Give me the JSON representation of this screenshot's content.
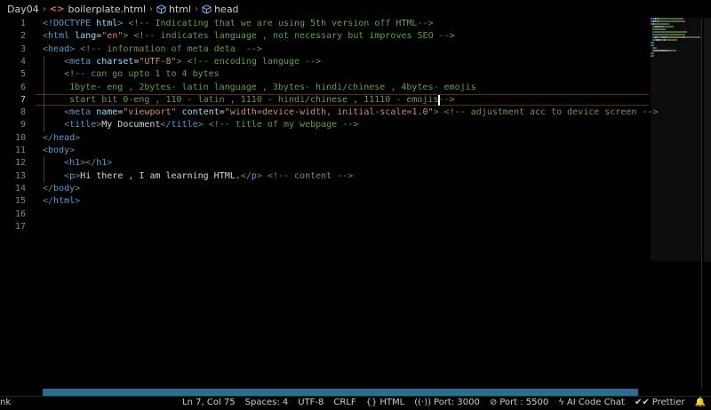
{
  "breadcrumb": {
    "folder": "Day04",
    "file": "boilerplate.html",
    "file_icon": "<>",
    "symbol1": "html",
    "symbol2": "head"
  },
  "editor": {
    "active_line": 7,
    "lines": [
      {
        "n": "1",
        "indent": 0,
        "t": [
          [
            "d",
            "<!DOCTYPE"
          ],
          [
            "x",
            " "
          ],
          [
            "a",
            "html"
          ],
          [
            "d",
            ">"
          ],
          [
            "x",
            " "
          ],
          [
            "c",
            "<!-- Indicating that we are using 5th version off HTML-->"
          ]
        ]
      },
      {
        "n": "2",
        "indent": 0,
        "t": [
          [
            "p",
            "<"
          ],
          [
            "t",
            "html"
          ],
          [
            "x",
            " "
          ],
          [
            "a",
            "lang"
          ],
          [
            "x",
            "="
          ],
          [
            "s",
            "\"en\""
          ],
          [
            "p",
            ">"
          ],
          [
            "x",
            " "
          ],
          [
            "c",
            "<!-- indicates language , not necessary but improves SEO -->"
          ]
        ]
      },
      {
        "n": "3",
        "indent": 0,
        "t": [
          [
            "p",
            "<"
          ],
          [
            "t",
            "head"
          ],
          [
            "p",
            ">"
          ],
          [
            "x",
            " "
          ],
          [
            "c",
            "<!-- information of meta deta  -->"
          ]
        ]
      },
      {
        "n": "4",
        "indent": 1,
        "t": [
          [
            "p",
            "<"
          ],
          [
            "t",
            "meta"
          ],
          [
            "x",
            " "
          ],
          [
            "a",
            "charset"
          ],
          [
            "x",
            "="
          ],
          [
            "s",
            "\"UTF-8\""
          ],
          [
            "p",
            ">"
          ],
          [
            "x",
            " "
          ],
          [
            "c",
            "<!-- encoding languge -->"
          ]
        ]
      },
      {
        "n": "5",
        "indent": 1,
        "t": [
          [
            "c",
            "<!-- can go upto 1 to 4 bytes"
          ]
        ]
      },
      {
        "n": "6",
        "indent": 1,
        "t": [
          [
            "c",
            " 1byte- eng , 2bytes- latin language , 3bytes- hindi/chinese , 4bytes- emojis"
          ]
        ]
      },
      {
        "n": "7",
        "indent": 1,
        "t": [
          [
            "c",
            " start bit 0-eng , 110 - latin , 1110 - hindi/chinese , 11110 - emojis-->"
          ]
        ]
      },
      {
        "n": "8",
        "indent": 1,
        "t": [
          [
            "p",
            "<"
          ],
          [
            "t",
            "meta"
          ],
          [
            "x",
            " "
          ],
          [
            "a",
            "name"
          ],
          [
            "x",
            "="
          ],
          [
            "s",
            "\"viewport\""
          ],
          [
            "x",
            " "
          ],
          [
            "a",
            "content"
          ],
          [
            "x",
            "="
          ],
          [
            "s",
            "\"width=device-width, initial-scale=1.0\""
          ],
          [
            "p",
            ">"
          ],
          [
            "x",
            " "
          ],
          [
            "c",
            "<!-- adjustment acc to device screen -->"
          ]
        ]
      },
      {
        "n": "9",
        "indent": 1,
        "t": [
          [
            "p",
            "<"
          ],
          [
            "t",
            "title"
          ],
          [
            "p",
            ">"
          ],
          [
            "x",
            "My Document"
          ],
          [
            "p",
            "</"
          ],
          [
            "t",
            "title"
          ],
          [
            "p",
            ">"
          ],
          [
            "x",
            " "
          ],
          [
            "c",
            "<!-- title of my webpage -->"
          ]
        ]
      },
      {
        "n": "10",
        "indent": 0,
        "t": [
          [
            "p",
            "</"
          ],
          [
            "t",
            "head"
          ],
          [
            "p",
            ">"
          ]
        ]
      },
      {
        "n": "11",
        "indent": 0,
        "t": [
          [
            "p",
            "<"
          ],
          [
            "t",
            "body"
          ],
          [
            "p",
            ">"
          ]
        ]
      },
      {
        "n": "12",
        "indent": 1,
        "t": [
          [
            "p",
            "<"
          ],
          [
            "t",
            "h1"
          ],
          [
            "p",
            "></"
          ],
          [
            "t",
            "h1"
          ],
          [
            "p",
            ">"
          ]
        ]
      },
      {
        "n": "13",
        "indent": 1,
        "t": [
          [
            "p",
            "<"
          ],
          [
            "t",
            "p"
          ],
          [
            "p",
            ">"
          ],
          [
            "x",
            "Hi there , I am learning HTML."
          ],
          [
            "p",
            "</"
          ],
          [
            "t",
            "p"
          ],
          [
            "p",
            ">"
          ],
          [
            "x",
            " "
          ],
          [
            "c",
            "<!-- content -->"
          ]
        ]
      },
      {
        "n": "14",
        "indent": 0,
        "t": [
          [
            "p",
            "</"
          ],
          [
            "t",
            "body"
          ],
          [
            "p",
            ">"
          ]
        ]
      },
      {
        "n": "15",
        "indent": 0,
        "t": [
          [
            "p",
            "</"
          ],
          [
            "t",
            "html"
          ],
          [
            "p",
            ">"
          ]
        ]
      },
      {
        "n": "16",
        "indent": 0,
        "t": []
      },
      {
        "n": "17",
        "indent": 0,
        "t": []
      }
    ]
  },
  "status": {
    "left_fragment": "nk",
    "position": "Ln 7, Col 75",
    "spaces": "Spaces: 4",
    "encoding": "UTF-8",
    "eol": "CRLF",
    "language": "HTML",
    "port1": "Port: 3000",
    "port2": "Port : 5500",
    "ai_chat": "AI Code Chat",
    "prettier": "Prettier"
  },
  "icons": {
    "language": "braces-icon",
    "port1": "broadcast-icon",
    "port2": "block-icon",
    "ai_chat": "lightning-icon",
    "prettier": "double-check-icon",
    "notifications": "bell-icon"
  },
  "colors": {
    "background": "#000000",
    "tag": "#569cd6",
    "attribute": "#9cdcfe",
    "string": "#ce9178",
    "comment": "#6a9955",
    "punctuation": "#808080",
    "text": "#d4d4d4",
    "horizontal_scrollbar": "#2d6d93",
    "current_line_border": "#5a2626"
  }
}
